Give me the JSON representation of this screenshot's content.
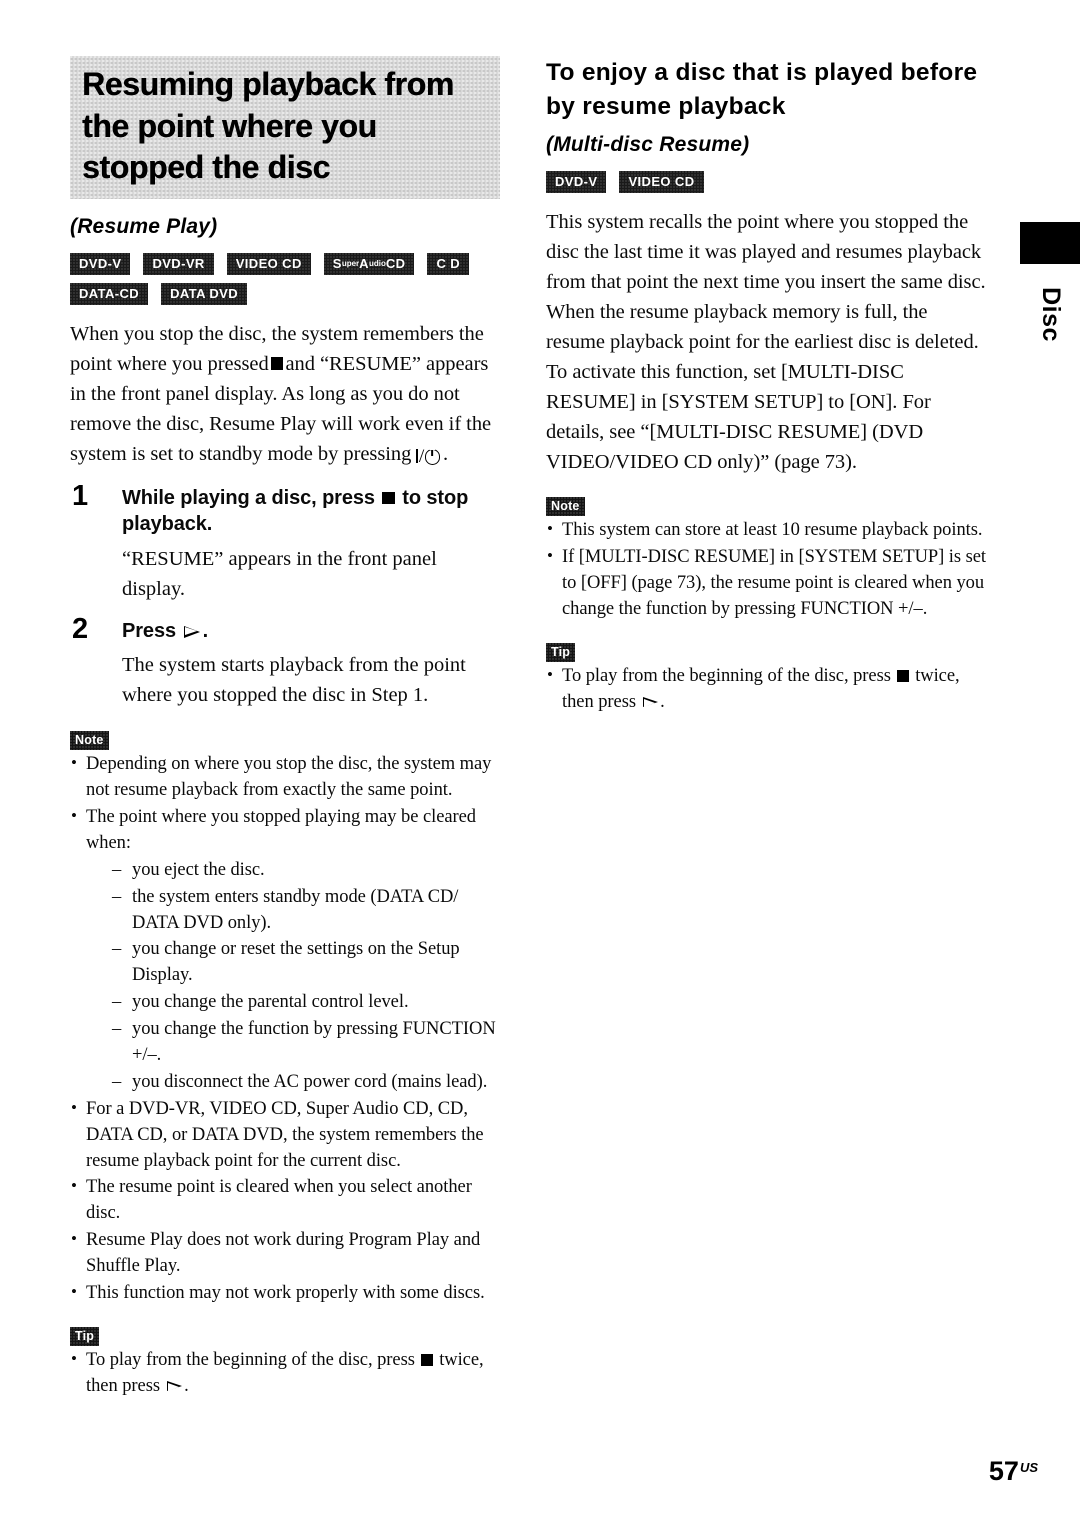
{
  "page": {
    "number": "57",
    "region_code": "US",
    "thumb_tab": "Disc"
  },
  "left_column": {
    "heading": "Resuming playback from the point where you stopped the disc",
    "subtitle": "(Resume Play)",
    "badges": [
      {
        "id": "dvd-v",
        "label": "DVD-V"
      },
      {
        "id": "dvd-vr",
        "label": "DVD-VR"
      },
      {
        "id": "video-cd",
        "label": "VIDEO CD"
      },
      {
        "id": "super-audio-cd",
        "label": "Super Audio CD",
        "parts": [
          "S",
          "uper",
          "A",
          "udio",
          "CD"
        ]
      },
      {
        "id": "cd",
        "label": "C D"
      },
      {
        "id": "data-cd",
        "label": "DATA-CD"
      },
      {
        "id": "data-dvd",
        "label": "DATA DVD"
      }
    ],
    "intro_part1": "When you stop the disc, the system remembers the point where you pressed",
    "intro_part2": "and “RESUME” appears in the front panel display. As long as you do not remove the disc, Resume Play will work even if the system is set to standby mode by pressing",
    "intro_part3": ".",
    "steps": [
      {
        "number": "1",
        "title_part1": "While playing a disc, press",
        "title_part2": "to stop playback.",
        "description": "“RESUME” appears in the front panel display."
      },
      {
        "number": "2",
        "title_part1": "Press",
        "title_part2": ".",
        "description": "The system starts playback from the point where you stopped the disc in Step 1."
      }
    ],
    "note_label": "Note",
    "notes": [
      {
        "text": "Depending on where you stop the disc, the system may not resume playback from exactly the same point."
      },
      {
        "text": "The point where you stopped playing may be cleared when:",
        "subitems": [
          "you eject the disc.",
          "the system enters standby mode (DATA CD/ DATA DVD only).",
          "you change or reset the settings on the Setup Display.",
          "you change the parental control level.",
          "you change the function by pressing FUNCTION +/–.",
          "you disconnect the AC power cord (mains lead)."
        ]
      },
      {
        "text": "For a DVD-VR, VIDEO CD, Super Audio CD, CD, DATA CD, or DATA DVD, the system remembers the resume playback point for the current disc."
      },
      {
        "text": "The resume point is cleared when you select another disc."
      },
      {
        "text": "Resume Play does not work during Program Play and Shuffle Play."
      },
      {
        "text": "This function may not work properly with some discs."
      }
    ],
    "tip_label": "Tip",
    "tip_part1": "To play from the beginning of the disc, press",
    "tip_part2": "twice, then press",
    "tip_part3": "."
  },
  "right_column": {
    "heading": "To enjoy a disc that is played before by resume playback",
    "subtitle": "(Multi-disc Resume)",
    "badges": [
      {
        "id": "dvd-v",
        "label": "DVD-V"
      },
      {
        "id": "video-cd",
        "label": "VIDEO CD"
      }
    ],
    "paragraph1": "This system recalls the point where you stopped the disc the last time it was played and resumes playback from that point the next time you insert the same disc. When the resume playback memory is full, the resume playback point for the earliest disc is deleted.",
    "paragraph2": "To activate this function, set [MULTI-DISC RESUME] in [SYSTEM SETUP] to [ON]. For details, see “[MULTI-DISC RESUME] (DVD VIDEO/VIDEO CD only)” (page 73).",
    "note_label": "Note",
    "notes": [
      {
        "text": "This system can store at least 10 resume playback points."
      },
      {
        "text": "If [MULTI-DISC RESUME] in [SYSTEM SETUP] is set to [OFF] (page 73), the resume point is cleared when you change the function by pressing FUNCTION +/–."
      }
    ],
    "tip_label": "Tip",
    "tip_part1": "To play from the beginning of the disc, press",
    "tip_part2": "twice, then press",
    "tip_part3": "."
  }
}
